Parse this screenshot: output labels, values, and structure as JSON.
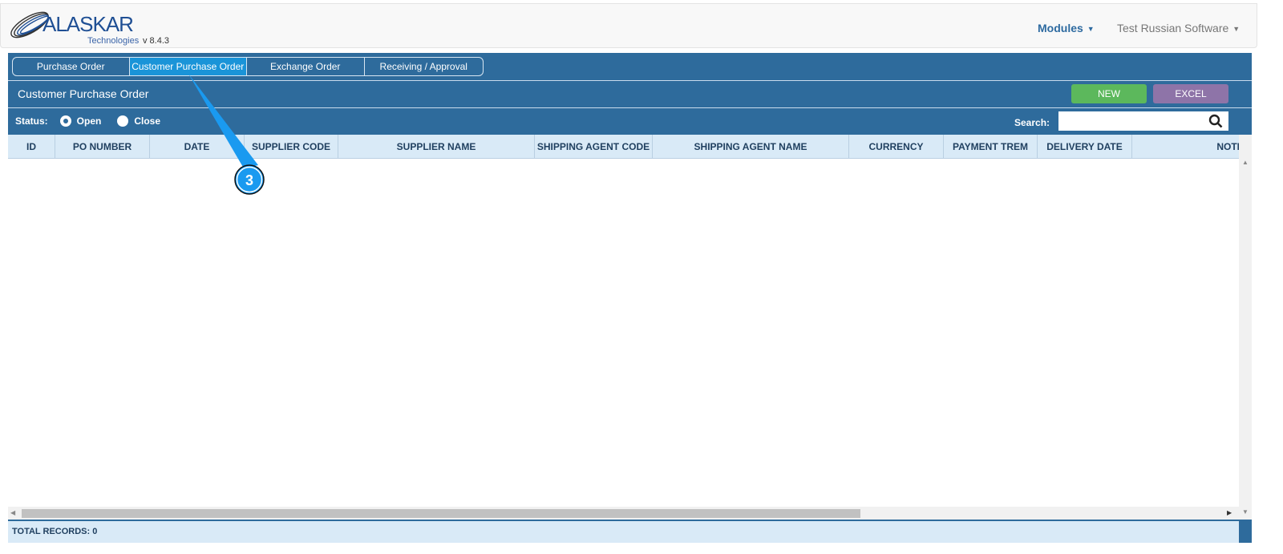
{
  "brand": {
    "name": "ALASKAR",
    "sub": "Technologies",
    "version": "v 8.4.3"
  },
  "nav": {
    "modules": "Modules",
    "user": "Test Russian Software"
  },
  "tabs": [
    {
      "label": "Purchase Order"
    },
    {
      "label": "Customer Purchase Order",
      "active": true
    },
    {
      "label": "Exchange Order"
    },
    {
      "label": "Receiving / Approval"
    }
  ],
  "page": {
    "title": "Customer Purchase Order",
    "new_label": "NEW",
    "excel_label": "EXCEL"
  },
  "filters": {
    "status_label": "Status:",
    "open_label": "Open",
    "close_label": "Close",
    "selected": "Open",
    "search_label": "Search:",
    "search_value": ""
  },
  "table": {
    "columns": [
      "ID",
      "PO NUMBER",
      "DATE",
      "SUPPLIER CODE",
      "SUPPLIER NAME",
      "SHIPPING AGENT CODE",
      "SHIPPING AGENT NAME",
      "CURRENCY",
      "PAYMENT TREM",
      "DELIVERY DATE",
      "NOTE"
    ],
    "rows": []
  },
  "footer": {
    "total": "TOTAL RECORDS: 0"
  },
  "annotation": {
    "label": "3"
  },
  "colors": {
    "panel": "#2e6b9c",
    "active_tab": "#1a94d8",
    "new": "#5cb85c",
    "excel": "#8e74a8",
    "callout": "#1a9af0"
  }
}
